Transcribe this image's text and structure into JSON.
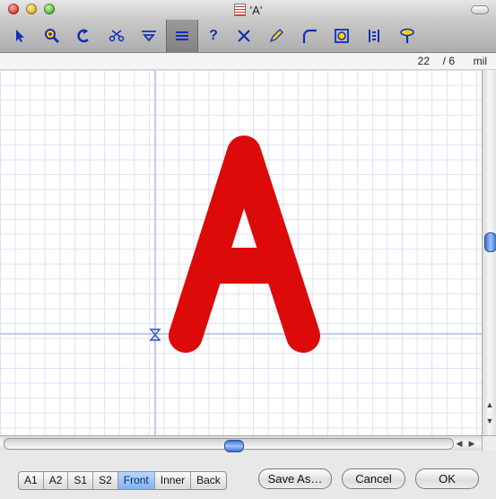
{
  "window": {
    "title": "'A'"
  },
  "toolbar": {
    "tools": [
      {
        "name": "select-arrow-icon"
      },
      {
        "name": "zoom-in-icon"
      },
      {
        "name": "rotate-icon"
      },
      {
        "name": "cut-icon"
      },
      {
        "name": "funnel-icon"
      },
      {
        "name": "lines-icon",
        "selected": true
      },
      {
        "name": "help-icon",
        "glyph": "?"
      },
      {
        "name": "cross-icon"
      },
      {
        "name": "pen-icon"
      },
      {
        "name": "corner-arc-icon"
      },
      {
        "name": "target-icon"
      },
      {
        "name": "align-icon"
      },
      {
        "name": "pin-icon"
      }
    ]
  },
  "status": {
    "width": "22",
    "separator": "/ 6",
    "unit": "mil"
  },
  "canvas": {
    "glyph": "A",
    "glyph_color": "#dd0a0a",
    "grid_color": "#dcdff5",
    "axis_color": "#c4cbef"
  },
  "layers": {
    "tabs": [
      {
        "label": "A1"
      },
      {
        "label": "A2"
      },
      {
        "label": "S1"
      },
      {
        "label": "S2"
      },
      {
        "label": "Front",
        "active": true
      },
      {
        "label": "Inner"
      },
      {
        "label": "Back"
      }
    ]
  },
  "buttons": {
    "save_as": "Save As…",
    "cancel": "Cancel",
    "ok": "OK"
  },
  "colors": {
    "accent": "#7fb2f5",
    "scroll_thumb": "#3d6fcf"
  }
}
